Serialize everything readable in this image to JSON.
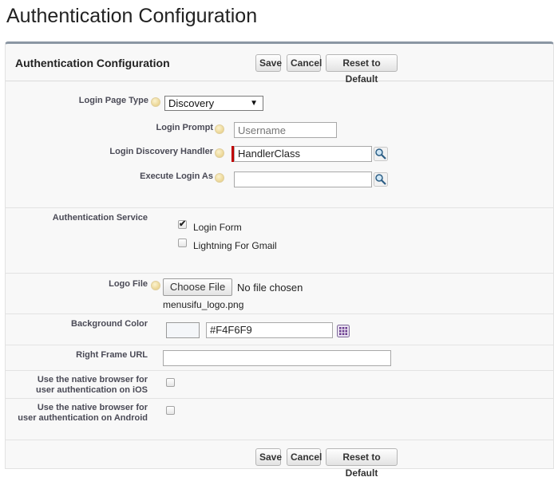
{
  "page": {
    "title": "Authentication Configuration"
  },
  "header": {
    "title": "Authentication Configuration",
    "save_label": "Save",
    "cancel_label": "Cancel",
    "reset_label": "Reset to Default"
  },
  "fields": {
    "login_page_type": {
      "label": "Login Page Type",
      "value": "Discovery",
      "arrow": "▼"
    },
    "login_prompt": {
      "label": "Login Prompt",
      "placeholder": "Username"
    },
    "login_discovery_handler": {
      "label": "Login Discovery Handler",
      "value": "HandlerClass"
    },
    "execute_login_as": {
      "label": "Execute Login As",
      "value": ""
    },
    "authentication_service": {
      "label": "Authentication Service",
      "options": [
        {
          "label": "Login Form",
          "checked": true
        },
        {
          "label": "Lightning For Gmail",
          "checked": false
        }
      ]
    },
    "logo_file": {
      "label": "Logo File",
      "button_label": "Choose File",
      "status": "No file chosen",
      "current_file": "menusifu_logo.png"
    },
    "background_color": {
      "label": "Background Color",
      "value": "#F4F6F9",
      "swatch_color": "#F4F6F9"
    },
    "right_frame_url": {
      "label": "Right Frame URL",
      "value": ""
    },
    "native_ios": {
      "label_line1": "Use the native browser for",
      "label_line2": "user authentication on iOS",
      "checked": false
    },
    "native_android": {
      "label_line1": "Use the native browser for",
      "label_line2": "user authentication on Android",
      "checked": false
    }
  },
  "footer": {
    "save_label": "Save",
    "cancel_label": "Cancel",
    "reset_label": "Reset to Default"
  },
  "icons": {
    "help": "help-icon",
    "lookup": "magnifier-lookup-icon",
    "color_picker": "color-grid-icon"
  },
  "colors": {
    "panel_border_top": "#8a96a3",
    "required_bar": "#c00000",
    "panel_bg": "#f8f8f8"
  }
}
